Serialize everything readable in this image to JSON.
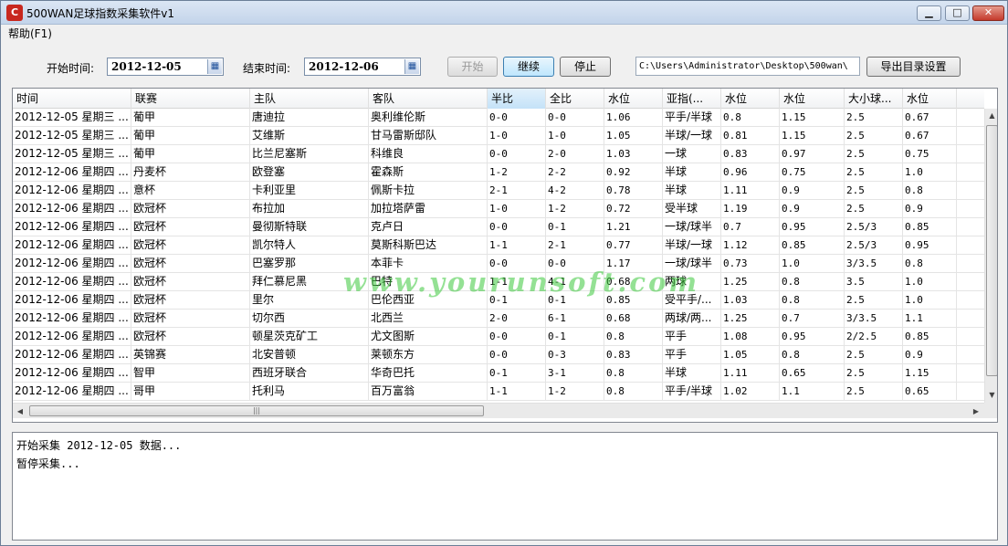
{
  "window": {
    "title": "500WAN足球指数采集软件v1",
    "icon_text": "C",
    "min_glyph": "▁",
    "max_glyph": "□",
    "close_glyph": "✕"
  },
  "menu": {
    "help": "帮助(F1)"
  },
  "controls": {
    "start_label": "开始时间:",
    "start_date": "2012-12-05",
    "end_label": "结束时间:",
    "end_date": "2012-12-06",
    "calendar_glyph": "▦",
    "btn_start": "开始",
    "btn_continue": "继续",
    "btn_stop": "停止",
    "path": "C:\\Users\\Administrator\\Desktop\\500wan\\",
    "btn_export": "导出目录设置"
  },
  "grid": {
    "columns": [
      "时间",
      "联赛",
      "主队",
      "客队",
      "半比",
      "全比",
      "水位",
      "亚指(...",
      "水位",
      "水位",
      "大小球...",
      "水位"
    ],
    "sorted_column": 4,
    "rows": [
      [
        "2012-12-05 星期三 ...",
        "葡甲",
        "唐迪拉",
        "奥利维伦斯",
        "0-0",
        "0-0",
        "1.06",
        "平手/半球",
        "0.8",
        "1.15",
        "2.5",
        "0.67"
      ],
      [
        "2012-12-05 星期三 ...",
        "葡甲",
        "艾维斯",
        "甘马雷斯邸队",
        "1-0",
        "1-0",
        "1.05",
        "半球/一球",
        "0.81",
        "1.15",
        "2.5",
        "0.67"
      ],
      [
        "2012-12-05 星期三 ...",
        "葡甲",
        "比兰尼塞斯",
        "科维良",
        "0-0",
        "2-0",
        "1.03",
        "一球",
        "0.83",
        "0.97",
        "2.5",
        "0.75"
      ],
      [
        "2012-12-06 星期四 ...",
        "丹麦杯",
        "欧登塞",
        "霍森斯",
        "1-2",
        "2-2",
        "0.92",
        "半球",
        "0.96",
        "0.75",
        "2.5",
        "1.0"
      ],
      [
        "2012-12-06 星期四 ...",
        "意杯",
        "卡利亚里",
        "佩斯卡拉",
        "2-1",
        "4-2",
        "0.78",
        "半球",
        "1.11",
        "0.9",
        "2.5",
        "0.8"
      ],
      [
        "2012-12-06 星期四 ...",
        "欧冠杯",
        "布拉加",
        "加拉塔萨雷",
        "1-0",
        "1-2",
        "0.72",
        "受半球",
        "1.19",
        "0.9",
        "2.5",
        "0.9"
      ],
      [
        "2012-12-06 星期四 ...",
        "欧冠杯",
        "曼彻斯特联",
        "克卢日",
        "0-0",
        "0-1",
        "1.21",
        "一球/球半",
        "0.7",
        "0.95",
        "2.5/3",
        "0.85"
      ],
      [
        "2012-12-06 星期四 ...",
        "欧冠杯",
        "凯尔特人",
        "莫斯科斯巴达",
        "1-1",
        "2-1",
        "0.77",
        "半球/一球",
        "1.12",
        "0.85",
        "2.5/3",
        "0.95"
      ],
      [
        "2012-12-06 星期四 ...",
        "欧冠杯",
        "巴塞罗那",
        "本菲卡",
        "0-0",
        "0-0",
        "1.17",
        "一球/球半",
        "0.73",
        "1.0",
        "3/3.5",
        "0.8"
      ],
      [
        "2012-12-06 星期四 ...",
        "欧冠杯",
        "拜仁慕尼黑",
        "巴特",
        "1-1",
        "4-1",
        "0.68",
        "两球",
        "1.25",
        "0.8",
        "3.5",
        "1.0"
      ],
      [
        "2012-12-06 星期四 ...",
        "欧冠杯",
        "里尔",
        "巴伦西亚",
        "0-1",
        "0-1",
        "0.85",
        "受平手/...",
        "1.03",
        "0.8",
        "2.5",
        "1.0"
      ],
      [
        "2012-12-06 星期四 ...",
        "欧冠杯",
        "切尔西",
        "北西兰",
        "2-0",
        "6-1",
        "0.68",
        "两球/两...",
        "1.25",
        "0.7",
        "3/3.5",
        "1.1"
      ],
      [
        "2012-12-06 星期四 ...",
        "欧冠杯",
        "顿星茨克矿工",
        "尤文图斯",
        "0-0",
        "0-1",
        "0.8",
        "平手",
        "1.08",
        "0.95",
        "2/2.5",
        "0.85"
      ],
      [
        "2012-12-06 星期四 ...",
        "英锦赛",
        "北安普顿",
        "莱顿东方",
        "0-0",
        "0-3",
        "0.83",
        "平手",
        "1.05",
        "0.8",
        "2.5",
        "0.9"
      ],
      [
        "2012-12-06 星期四 ...",
        "智甲",
        "西班牙联合",
        "华奇巴托",
        "0-1",
        "3-1",
        "0.8",
        "半球",
        "1.11",
        "0.65",
        "2.5",
        "1.15"
      ],
      [
        "2012-12-06 星期四 ...",
        "哥甲",
        "托利马",
        "百万富翁",
        "1-1",
        "1-2",
        "0.8",
        "平手/半球",
        "1.02",
        "1.1",
        "2.5",
        "0.65"
      ]
    ],
    "scroll_up": "▲",
    "scroll_down": "▼",
    "scroll_left": "◀",
    "scroll_right": "▶",
    "grip": "|||"
  },
  "watermark": "www.yourunsoft.com",
  "log": {
    "lines": [
      "开始采集 2012-12-05 数据...",
      "暂停采集..."
    ]
  }
}
